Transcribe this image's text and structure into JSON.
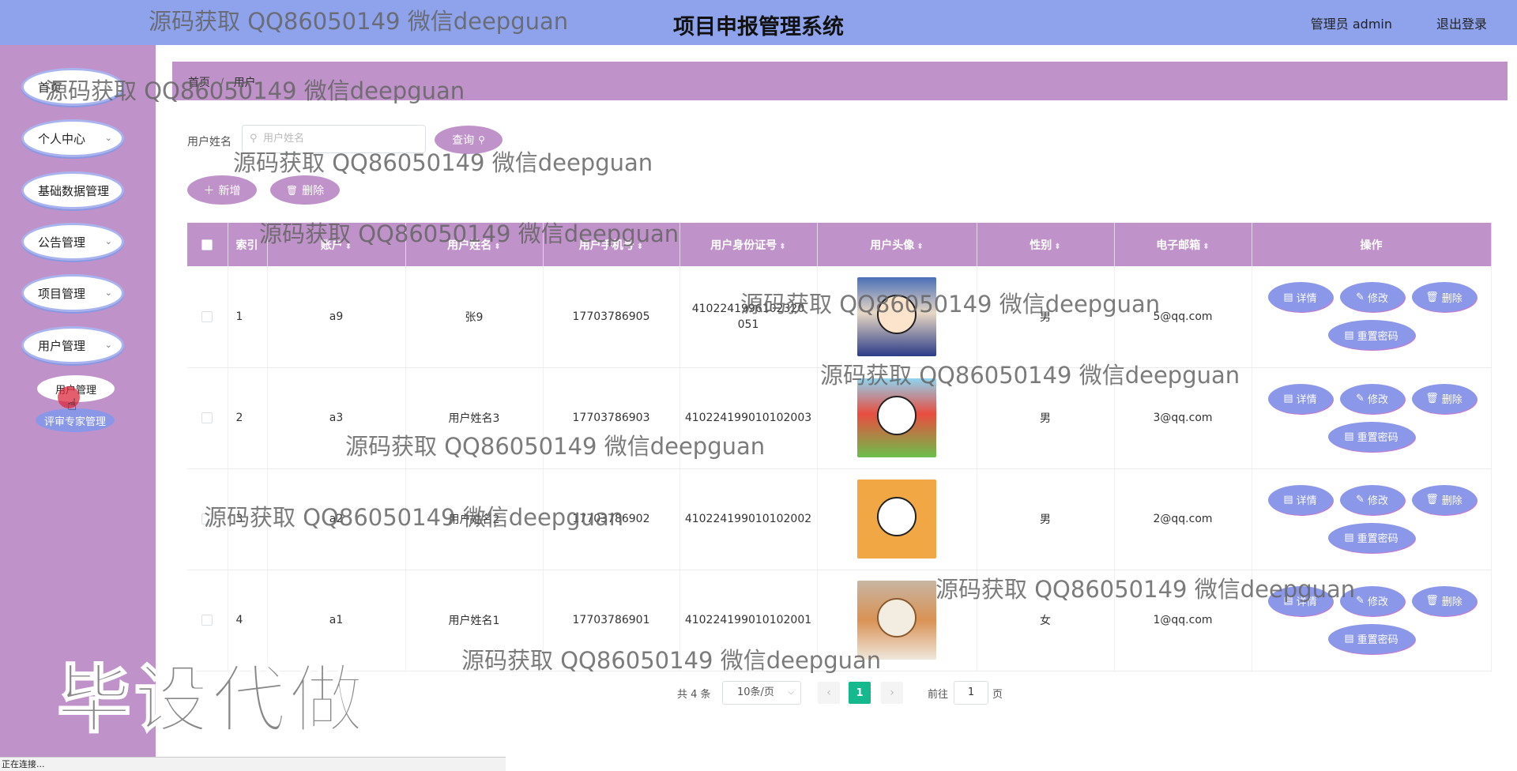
{
  "header": {
    "title": "项目申报管理系统",
    "user_info": "管理员 admin",
    "logout": "退出登录"
  },
  "sidebar": {
    "items": [
      {
        "label": "首页",
        "chevron": ""
      },
      {
        "label": "个人中心",
        "chevron": "⌄"
      },
      {
        "label": "基础数据管理",
        "chevron": ""
      },
      {
        "label": "公告管理",
        "chevron": "⌄"
      },
      {
        "label": "项目管理",
        "chevron": "⌄"
      },
      {
        "label": "用户管理",
        "chevron": "⌄"
      }
    ],
    "sub_items": [
      {
        "label": "用户管理"
      },
      {
        "label": "评审专家管理"
      }
    ]
  },
  "breadcrumb": {
    "home": "首页",
    "separator": "/",
    "current": "用户"
  },
  "search": {
    "label": "用户姓名",
    "placeholder": "用户姓名",
    "query_button": "查询"
  },
  "actions": {
    "add": "新增",
    "delete": "删除"
  },
  "table": {
    "headers": [
      "索引",
      "账户",
      "用户姓名",
      "用户手机号",
      "用户身份证号",
      "用户头像",
      "性别",
      "电子邮箱",
      "操作"
    ],
    "rows": [
      {
        "index": "1",
        "account": "a9",
        "name": "张9",
        "phone": "17703786905",
        "id_card": "4102241996102320051",
        "gender": "男",
        "email": "5@qq.com"
      },
      {
        "index": "2",
        "account": "a3",
        "name": "用户姓名3",
        "phone": "17703786903",
        "id_card": "410224199010102003",
        "gender": "男",
        "email": "3@qq.com"
      },
      {
        "index": "3",
        "account": "a2",
        "name": "用户姓名2",
        "phone": "17703786902",
        "id_card": "410224199010102002",
        "gender": "男",
        "email": "2@qq.com"
      },
      {
        "index": "4",
        "account": "a1",
        "name": "用户姓名1",
        "phone": "17703786901",
        "id_card": "410224199010102001",
        "gender": "女",
        "email": "1@qq.com"
      }
    ],
    "ops": {
      "detail": "详情",
      "edit": "修改",
      "delete": "删除",
      "reset": "重置密码"
    }
  },
  "pagination": {
    "total": "共 4 条",
    "page_size": "10条/页",
    "current_page": "1",
    "goto_label": "前往",
    "goto_value": "1",
    "page_suffix": "页"
  },
  "status_bar": "正在连接...",
  "watermark": {
    "text": "源码获取 QQ86050149 微信deepguan",
    "big": "毕设代做"
  }
}
